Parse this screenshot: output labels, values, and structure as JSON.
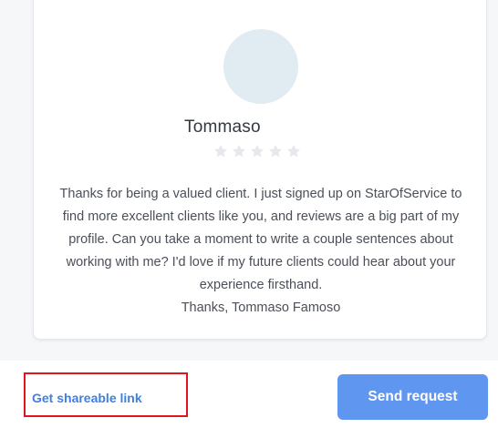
{
  "review_card": {
    "name": "Tommaso",
    "rating": 0,
    "max_rating": 5,
    "message_lines": [
      "Thanks for being a valued client. I just signed up on StarOfService to",
      "find more excellent clients like you, and reviews are a big part of my",
      "profile. Can you take a moment to write a couple sentences about",
      "working with me? I'd love if my future clients could hear about your",
      "experience firsthand.",
      "Thanks, Tommaso Famoso"
    ]
  },
  "actions": {
    "share_link_label": "Get shareable link",
    "send_request_label": "Send request"
  },
  "colors": {
    "accent": "#5f96f0",
    "link": "#3f7fe0",
    "avatar_bg": "#e1ecf2",
    "star_empty": "#e6e8ec",
    "highlight": "#e0141e"
  }
}
